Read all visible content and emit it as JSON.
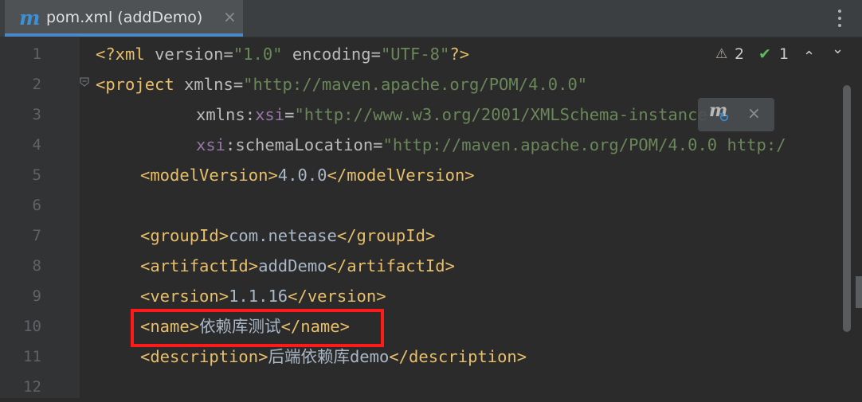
{
  "tab": {
    "icon": "maven-icon",
    "icon_glyph": "m",
    "title": "pom.xml (addDemo)",
    "close_glyph": "×"
  },
  "menu": {
    "icon": "more-vertical-icon"
  },
  "inspections": {
    "warning_count": "2",
    "ok_count": "1",
    "warning_glyph": "⚠",
    "ok_glyph": "✔",
    "up_glyph": "⌃",
    "down_glyph": "⌄"
  },
  "maven_popup": {
    "icon_glyph": "m",
    "refresh_glyph": "↻",
    "close_glyph": "×"
  },
  "line_numbers": [
    "1",
    "2",
    "3",
    "4",
    "5",
    "6",
    "7",
    "8",
    "9",
    "10",
    "11",
    "12"
  ],
  "code": {
    "l1": {
      "open": "<?xml ",
      "a1": "version",
      "eq1": "=",
      "v1": "\"1.0\"",
      "sp": " ",
      "a2": "encoding",
      "eq2": "=",
      "v2": "\"UTF-8\"",
      "close": "?>"
    },
    "l2": {
      "open": "<project ",
      "a1": "xmlns",
      "eq1": "=",
      "v1": "\"http://maven.apache.org/POM/4.0.0\""
    },
    "l3": {
      "ns": "xmlns",
      "colon": ":",
      "ns2": "xsi",
      "eq": "=",
      "v": "\"http://www.w3.org/2001/XMLSchema-instance\""
    },
    "l4": {
      "ns": "xsi",
      "colon": ":",
      "a": "schemaLocation",
      "eq": "=",
      "v": "\"http://maven.apache.org/POM/4.0.0 http:/"
    },
    "l5": {
      "open": "<modelVersion>",
      "text": "4.0.0",
      "close": "</modelVersion>"
    },
    "l7": {
      "open": "<groupId>",
      "text": "com.netease",
      "close": "</groupId>"
    },
    "l8": {
      "open": "<artifactId>",
      "text": "addDemo",
      "close": "</artifactId>"
    },
    "l9": {
      "open": "<version>",
      "text": "1.1.16",
      "close": "</version>"
    },
    "l10": {
      "open": "<name>",
      "text": "依赖库测试",
      "close": "</name>"
    },
    "l11": {
      "open": "<description>",
      "text": "后端依赖库demo",
      "close": "</description>"
    }
  },
  "colors": {
    "background": "#2b2b2b",
    "tag": "#e8bf6a",
    "string": "#6a8759",
    "namespace": "#9876aa",
    "highlight_box": "#ff1a1a",
    "tab_accent": "#4a88c7"
  }
}
